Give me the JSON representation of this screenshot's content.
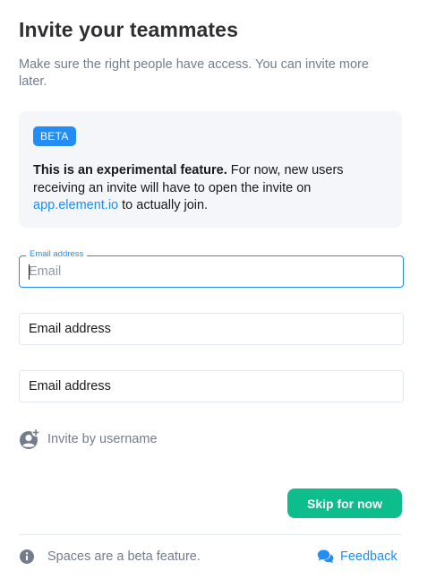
{
  "header": {
    "title": "Invite your teammates",
    "subtitle": "Make sure the right people have access. You can invite more later."
  },
  "beta_notice": {
    "badge": "BETA",
    "strong_text": "This is an experimental feature.",
    "text_before_link": " For now, new users receiving an invite will have to open the invite on ",
    "link_text": "app.element.io",
    "text_after_link": " to actually join."
  },
  "email_fields": [
    {
      "label": "Email address",
      "placeholder": "Email",
      "value": ""
    },
    {
      "placeholder": "Email address",
      "value": ""
    },
    {
      "placeholder": "Email address",
      "value": ""
    }
  ],
  "invite_by_username": {
    "label": "Invite by username",
    "icon": "add-user-icon"
  },
  "skip_button": {
    "label": "Skip for now"
  },
  "footer": {
    "beta_info": "Spaces are a beta feature.",
    "info_icon": "info-icon",
    "feedback_label": "Feedback",
    "feedback_icon": "chat-bubbles-icon"
  },
  "colors": {
    "accent": "#238cf5",
    "primary_button": "#0dbd8b",
    "muted_text": "#737d8c",
    "card_background": "#f4f6fa"
  }
}
